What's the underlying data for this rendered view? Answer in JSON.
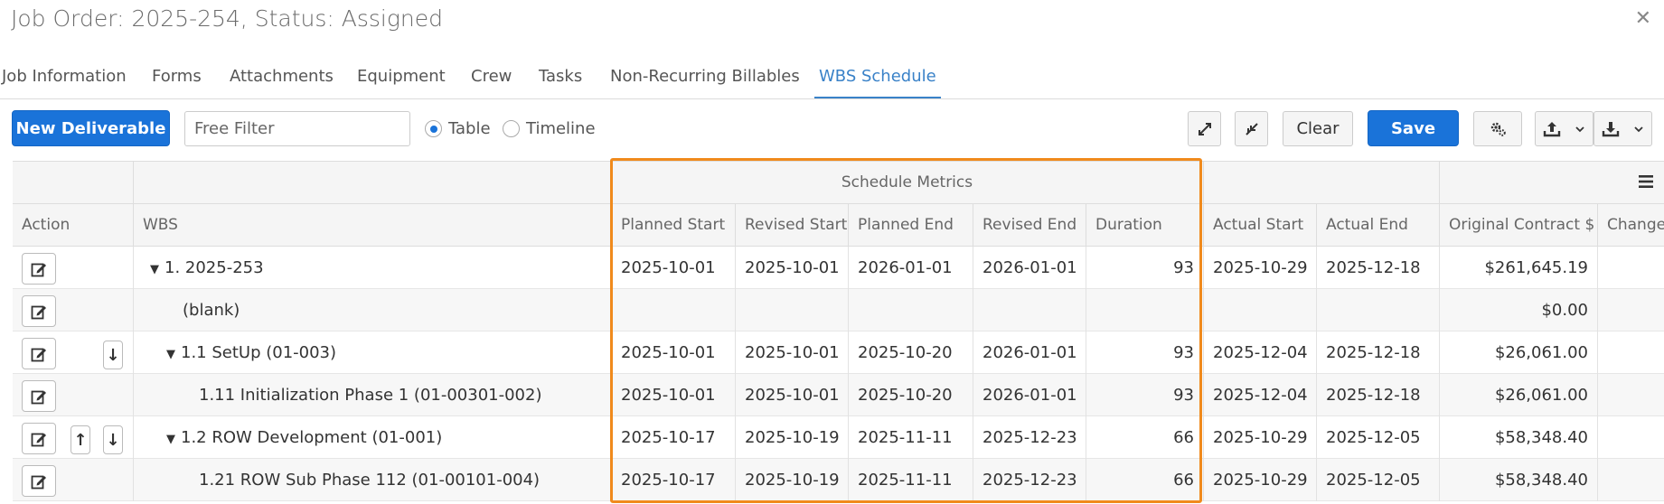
{
  "window": {
    "title": "Job Order: 2025-254, Status: Assigned"
  },
  "tabs": [
    {
      "label": "Job Information"
    },
    {
      "label": "Forms"
    },
    {
      "label": "Attachments"
    },
    {
      "label": "Equipment"
    },
    {
      "label": "Crew"
    },
    {
      "label": "Tasks"
    },
    {
      "label": "Non-Recurring Billables"
    },
    {
      "label": "WBS Schedule",
      "active": true
    }
  ],
  "toolbar": {
    "new_deliverable": "New Deliverable",
    "filter_placeholder": "Free Filter",
    "view_table": "Table",
    "view_timeline": "Timeline",
    "selected_view": "Table",
    "clear": "Clear",
    "save": "Save"
  },
  "grid": {
    "group_header": "Schedule Metrics",
    "columns": [
      "Action",
      "WBS",
      "Planned Start",
      "Revised Start",
      "Planned End",
      "Revised End",
      "Duration",
      "Actual Start",
      "Actual End",
      "Original Contract $",
      "Changes"
    ],
    "rows": [
      {
        "wbs": "1. 2025-253",
        "expanded": true,
        "planned_start": "2025-10-01",
        "revised_start": "2025-10-01",
        "planned_end": "2026-01-01",
        "revised_end": "2026-01-01",
        "duration": "93",
        "actual_start": "2025-10-29",
        "actual_end": "2025-12-18",
        "contract": "$261,645.19"
      },
      {
        "wbs": "(blank)",
        "planned_start": "",
        "revised_start": "",
        "planned_end": "",
        "revised_end": "",
        "duration": "",
        "actual_start": "",
        "actual_end": "",
        "contract": "$0.00"
      },
      {
        "wbs": "1.1 SetUp (01-003)",
        "expanded": true,
        "planned_start": "2025-10-01",
        "revised_start": "2025-10-01",
        "planned_end": "2025-10-20",
        "revised_end": "2026-01-01",
        "duration": "93",
        "actual_start": "2025-12-04",
        "actual_end": "2025-12-18",
        "contract": "$26,061.00"
      },
      {
        "wbs": "1.11 Initialization Phase 1 (01-00301-002)",
        "planned_start": "2025-10-01",
        "revised_start": "2025-10-01",
        "planned_end": "2025-10-20",
        "revised_end": "2026-01-01",
        "duration": "93",
        "actual_start": "2025-12-04",
        "actual_end": "2025-12-18",
        "contract": "$26,061.00"
      },
      {
        "wbs": "1.2 ROW Development (01-001)",
        "expanded": true,
        "planned_start": "2025-10-17",
        "revised_start": "2025-10-19",
        "planned_end": "2025-11-11",
        "revised_end": "2025-12-23",
        "duration": "66",
        "actual_start": "2025-10-29",
        "actual_end": "2025-12-05",
        "contract": "$58,348.40"
      },
      {
        "wbs": "1.21 ROW Sub Phase 112 (01-00101-004)",
        "planned_start": "2025-10-17",
        "revised_start": "2025-10-19",
        "planned_end": "2025-11-11",
        "revised_end": "2025-12-23",
        "duration": "66",
        "actual_start": "2025-10-29",
        "actual_end": "2025-12-05",
        "contract": "$58,348.40"
      }
    ]
  },
  "highlight_color": "#f08a1c",
  "accent_color": "#1a73d9"
}
